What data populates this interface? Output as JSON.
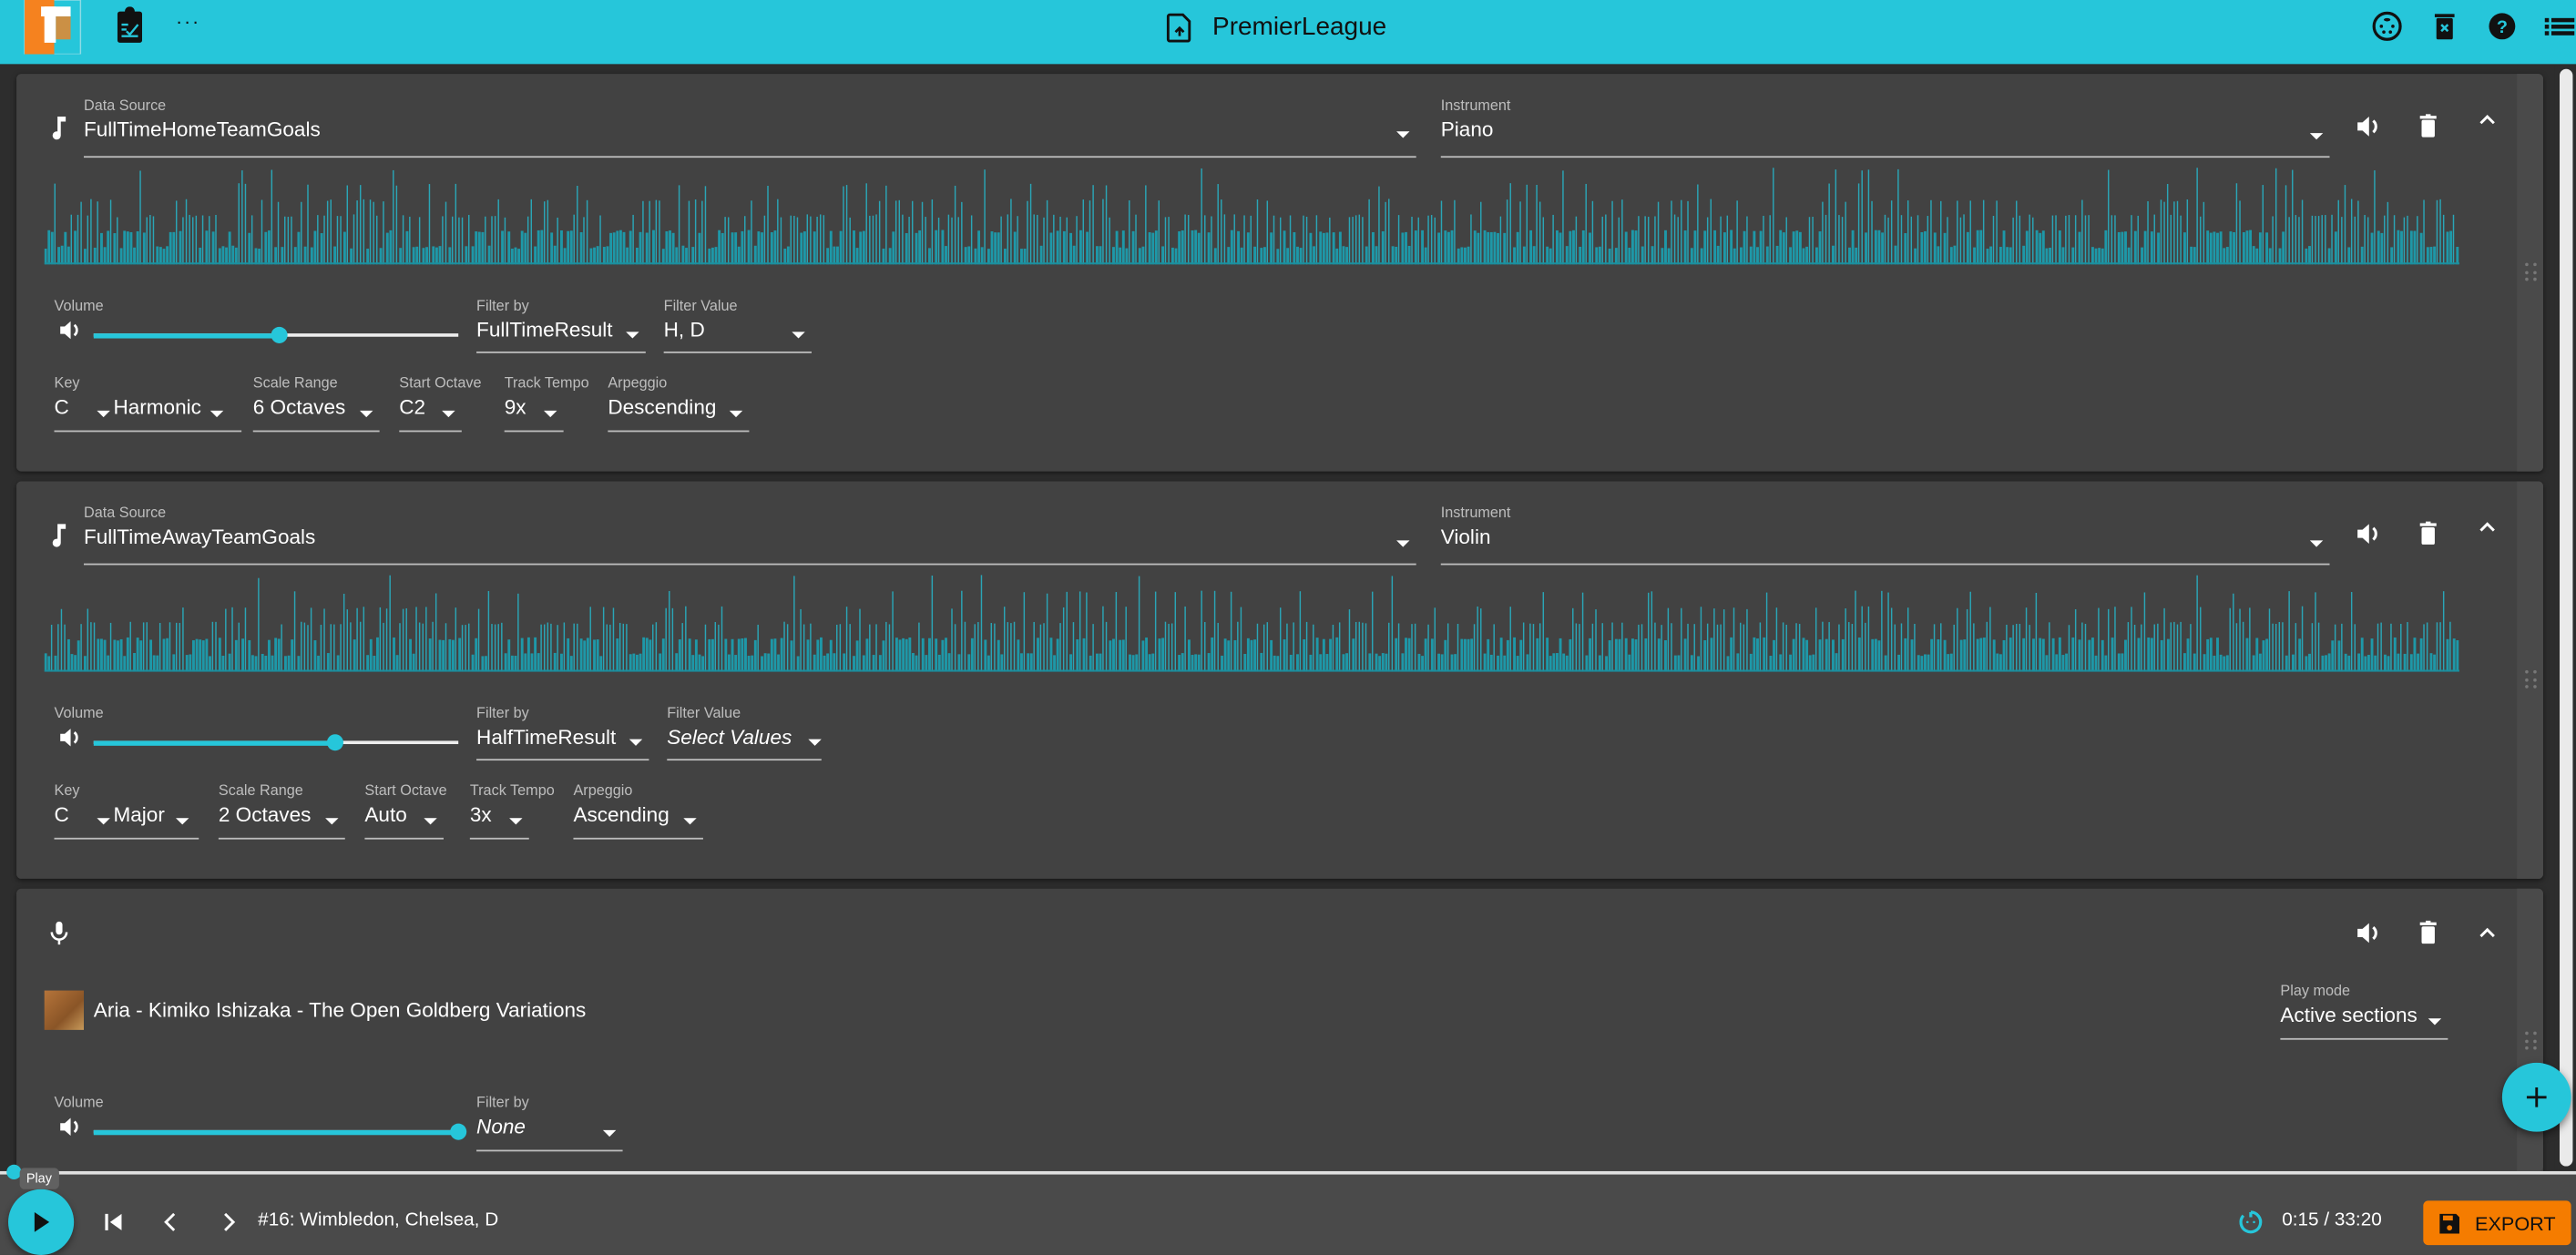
{
  "header": {
    "title": "PremierLeague",
    "icons": [
      "logo-icon",
      "notes-icon",
      "more-icon",
      "file-upload-icon",
      "settings-dial-icon",
      "clear-all-icon",
      "help-icon",
      "list-icon"
    ]
  },
  "tracks": [
    {
      "type": "data",
      "data_source_label": "Data Source",
      "data_source": "FullTimeHomeTeamGoals",
      "instrument_label": "Instrument",
      "instrument": "Piano",
      "volume_label": "Volume",
      "volume": 0.51,
      "filter_by_label": "Filter by",
      "filter_by": "FullTimeResult",
      "filter_value_label": "Filter Value",
      "filter_value": "H, D",
      "key_label": "Key",
      "key": "C",
      "scale": "Harmonic",
      "scale_range_label": "Scale Range",
      "scale_range": "6 Octaves",
      "start_octave_label": "Start Octave",
      "start_octave": "C2",
      "track_tempo_label": "Track Tempo",
      "track_tempo": "9x",
      "arpeggio_label": "Arpeggio",
      "arpeggio": "Descending"
    },
    {
      "type": "data",
      "data_source_label": "Data Source",
      "data_source": "FullTimeAwayTeamGoals",
      "instrument_label": "Instrument",
      "instrument": "Violin",
      "volume_label": "Volume",
      "volume": 0.66,
      "filter_by_label": "Filter by",
      "filter_by": "HalfTimeResult",
      "filter_value_label": "Filter Value",
      "filter_value": "Select Values",
      "key_label": "Key",
      "key": "C",
      "scale": "Major",
      "scale_range_label": "Scale Range",
      "scale_range": "2 Octaves",
      "start_octave_label": "Start Octave",
      "start_octave": "Auto",
      "track_tempo_label": "Track Tempo",
      "track_tempo": "3x",
      "arpeggio_label": "Arpeggio",
      "arpeggio": "Ascending"
    },
    {
      "type": "audio",
      "track_title": "Aria - Kimiko Ishizaka - The Open Goldberg Variations",
      "play_mode_label": "Play mode",
      "play_mode": "Active sections",
      "volume_label": "Volume",
      "volume": 1.0,
      "filter_by_label": "Filter by",
      "filter_by": "None"
    }
  ],
  "player": {
    "tooltip": "Play",
    "now_playing": "#16: Wimbledon, Chelsea, D",
    "time": "0:15 / 33:20",
    "progress": 0.0075,
    "export_label": "EXPORT"
  },
  "colors": {
    "accent": "#26c6da",
    "export": "#f57c00",
    "card": "#424242"
  }
}
